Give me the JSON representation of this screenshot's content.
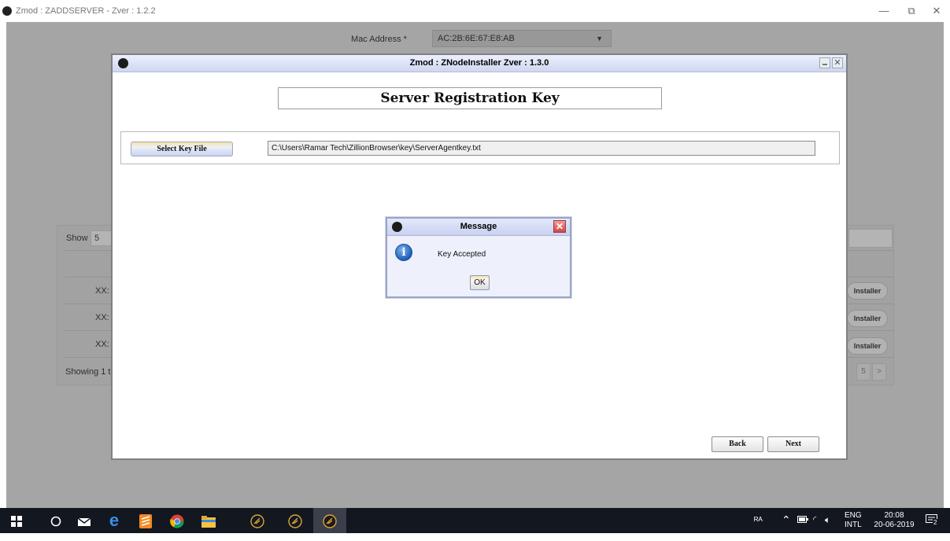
{
  "window": {
    "title": "Zmod : ZADDSERVER - Zver : 1.2.2",
    "controls": {
      "minimize": "—",
      "restore": "⧉",
      "close": "✕"
    }
  },
  "background": {
    "mac_label": "Mac Address *",
    "mac_value": "AC:2B:6E:67:E8:AB",
    "show_label": "Show",
    "show_value": "5",
    "rows": [
      {
        "name": "XX:",
        "button": "Installer"
      },
      {
        "name": "XX:",
        "button": "Installer"
      },
      {
        "name": "XX:",
        "button": "Installer"
      }
    ],
    "showing_text": "Showing 1 t",
    "pager": {
      "page": "5",
      "next": ">"
    }
  },
  "installer": {
    "title": "Zmod : ZNodeInstaller Zver : 1.3.0",
    "heading": "Server Registration Key",
    "select_button": "Select Key File",
    "path_value": "C:\\Users\\Ramar Tech\\ZillionBrowser\\key\\ServerAgentkey.txt",
    "back_button": "Back",
    "next_button": "Next"
  },
  "message": {
    "title": "Message",
    "text": "Key Accepted",
    "ok_button": "OK"
  },
  "taskbar": {
    "apps": [
      "windows-start-icon",
      "cortana-search-icon",
      "mail-icon",
      "edge-browser-icon",
      "sublime-text-icon",
      "chrome-icon",
      "file-explorer-icon",
      "zmod-app-icon",
      "zmod-app-icon",
      "zmod-app-icon"
    ],
    "lang_top": "ENG",
    "lang_bottom": "INTL",
    "time": "20:08",
    "date": "20-06-2019",
    "notification_count": "2"
  }
}
